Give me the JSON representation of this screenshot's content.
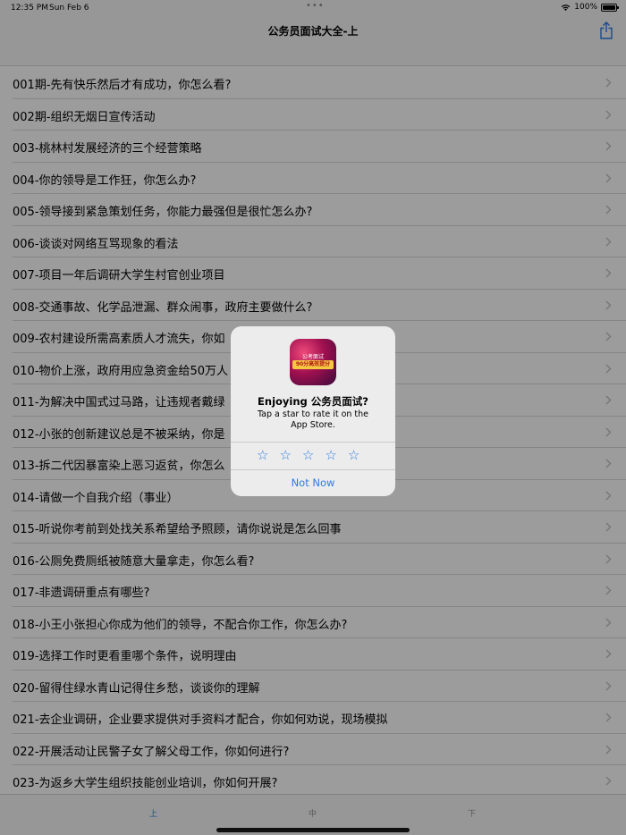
{
  "status": {
    "time": "12:35 PM",
    "date": "Sun Feb 6",
    "dots": "•••",
    "battery": "100%"
  },
  "nav": {
    "title": "公务员面试大全-上",
    "share_icon": "share-icon"
  },
  "list": {
    "items": [
      "001期-先有快乐然后才有成功，你怎么看?",
      "002期-组织无烟日宣传活动",
      "003-桃林村发展经济的三个经营策略",
      "004-你的领导是工作狂，你怎么办?",
      "005-领导接到紧急策划任务，你能力最强但是很忙怎么办?",
      "006-谈谈对网络互骂现象的看法",
      "007-项目一年后调研大学生村官创业项目",
      "008-交通事故、化学品泄漏、群众闹事，政府主要做什么?",
      "009-农村建设所需高素质人才流失，你如",
      "010-物价上涨，政府用应急资金给50万人",
      "011-为解决中国式过马路，让违规者戴绿",
      "012-小张的创新建议总是不被采纳，你是",
      "013-拆二代因暴富染上恶习返贫，你怎么",
      "014-请做一个自我介绍（事业）",
      "015-听说你考前到处找关系希望给予照顾，请你说说是怎么回事",
      "016-公厕免费厕纸被随意大量拿走，你怎么看?",
      "017-非遗调研重点有哪些?",
      "018-小王小张担心你成为他们的领导，不配合你工作，你怎么办?",
      "019-选择工作时更看重哪个条件，说明理由",
      "020-留得住绿水青山记得住乡愁，谈谈你的理解",
      "021-去企业调研，企业要求提供对手资料才配合，你如何劝说，现场模拟",
      "022-开展活动让民警子女了解父母工作，你如何进行?",
      "023-为返乡大学生组织技能创业培训，你如何开展?"
    ]
  },
  "tabs": [
    {
      "label": "上",
      "active": true
    },
    {
      "label": "中",
      "active": false
    },
    {
      "label": "下",
      "active": false
    }
  ],
  "alert": {
    "title": "Enjoying 公务员面试?",
    "message": "Tap a star to rate it on the App Store.",
    "stars": [
      "☆",
      "☆",
      "☆",
      "☆",
      "☆"
    ],
    "not_now": "Not Now",
    "app_icon": {
      "top_text": "公考面试",
      "band_text": "90分高效提分"
    }
  },
  "colors": {
    "accent": "#2f7be0",
    "overlay": "rgba(0,0,0,0.39)"
  }
}
